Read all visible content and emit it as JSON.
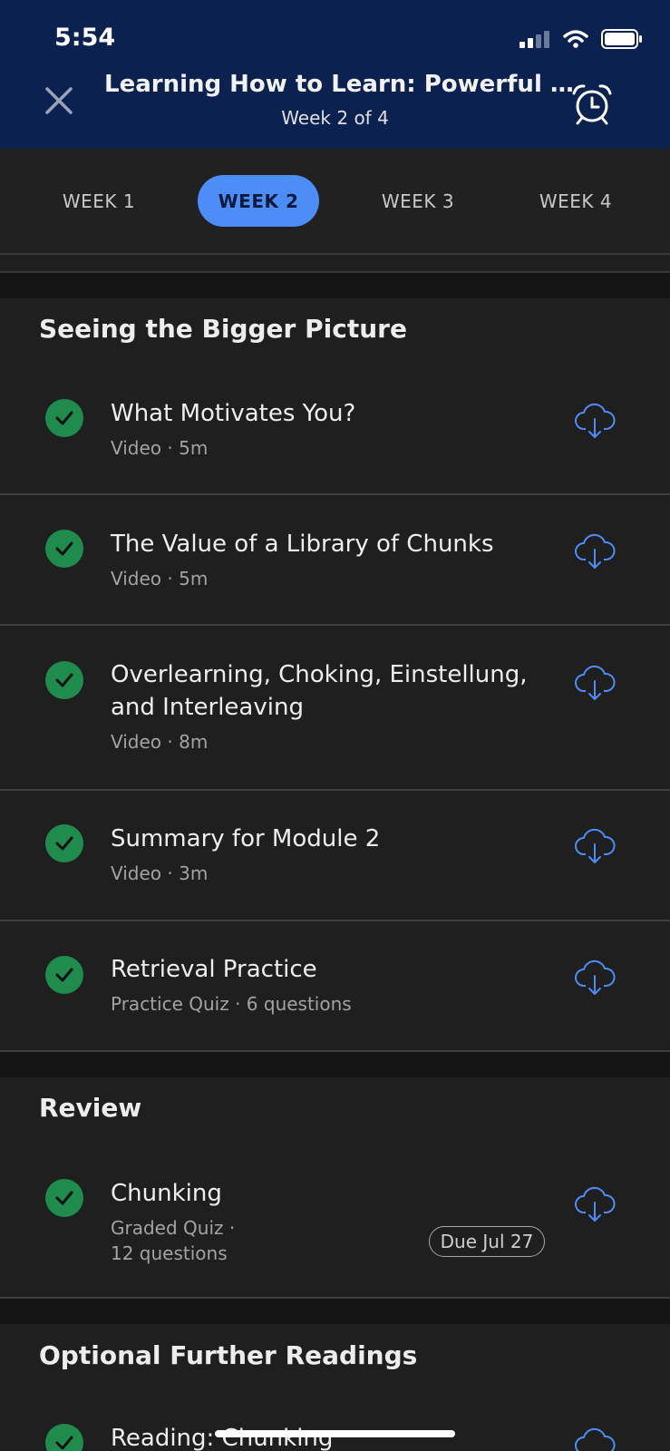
{
  "status": {
    "time": "5:54"
  },
  "header": {
    "title": "Learning How to Learn: Powerful me...",
    "subtitle": "Week 2 of 4"
  },
  "tabs": [
    {
      "label": "WEEK 1"
    },
    {
      "label": "WEEK 2",
      "active": true
    },
    {
      "label": "WEEK 3"
    },
    {
      "label": "WEEK 4"
    }
  ],
  "sections": [
    {
      "title": "Seeing the Bigger Picture",
      "items": [
        {
          "title": "What Motivates You?",
          "meta": "Video · 5m"
        },
        {
          "title": "The Value of a Library of Chunks",
          "meta": "Video · 5m"
        },
        {
          "title": "Overlearning, Choking, Einstellung, and Interleaving",
          "meta": "Video · 8m"
        },
        {
          "title": "Summary for Module 2",
          "meta": "Video · 3m"
        },
        {
          "title": "Retrieval Practice",
          "meta": "Practice Quiz · 6 questions"
        }
      ]
    },
    {
      "title": "Review",
      "items": [
        {
          "title": "Chunking",
          "meta_line1": "Graded Quiz ·",
          "meta_line2": "12 questions",
          "due": "Due Jul 27"
        }
      ]
    },
    {
      "title": "Optional Further Readings",
      "items": [
        {
          "title": "Reading: Chunking"
        }
      ]
    }
  ],
  "colors": {
    "header_bg": "#0b2150",
    "accent": "#4d8df7",
    "complete": "#1f8c4e",
    "download_icon": "#4d8df7"
  },
  "icons": [
    "close-icon",
    "alarm-clock-icon",
    "check-icon",
    "cloud-download-icon",
    "signal-icon",
    "wifi-icon",
    "battery-icon"
  ]
}
